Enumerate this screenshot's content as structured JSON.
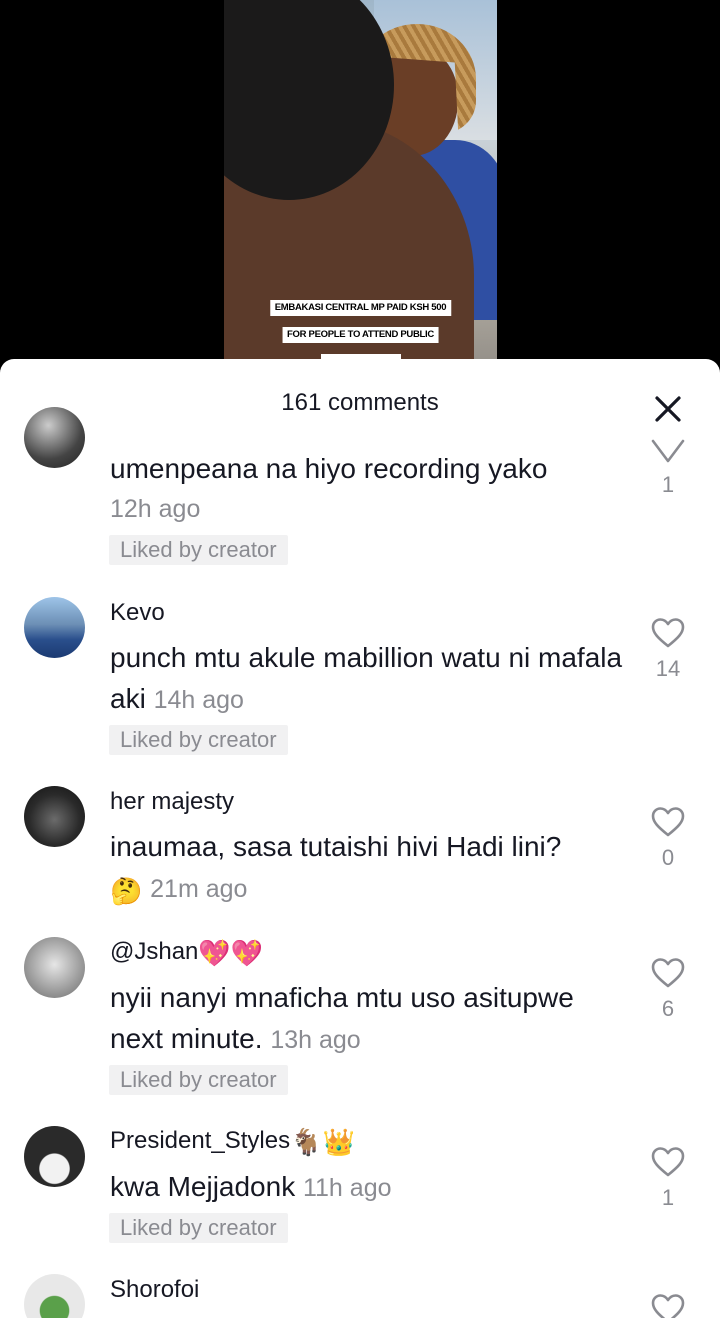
{
  "video": {
    "caption_lines": [
      "EMBAKASI CENTRAL MP PAID KSH 500",
      "FOR PEOPLE TO ATTEND PUBLIC"
    ]
  },
  "sheet": {
    "title": "161 comments",
    "close_icon": "close-icon"
  },
  "comments": [
    {
      "username": "",
      "text": "umenpeana na hiyo recording yako",
      "time": "12h ago",
      "liked_label": "Liked by creator",
      "likes": "1"
    },
    {
      "username": "Kevo",
      "text": "punch mtu akule mabillion watu ni mafala aki",
      "time": "14h ago",
      "liked_label": "Liked by creator",
      "likes": "14"
    },
    {
      "username": "her majesty",
      "text": "inaumaa, sasa tutaishi hivi Hadi lini?",
      "text_emoji": "🤔",
      "time": "21m ago",
      "likes": "0"
    },
    {
      "username": "@Jshan",
      "username_emoji": "💖💖",
      "text": "nyii nanyi mnaficha mtu uso asitupwe next minute.",
      "time": "13h ago",
      "liked_label": "Liked by creator",
      "likes": "6"
    },
    {
      "username": "President_Styles",
      "username_emoji": "🐐👑",
      "text": "kwa Mejjadonk",
      "time": "11h ago",
      "liked_label": "Liked by creator",
      "likes": "1"
    },
    {
      "username": "Shorofoi"
    }
  ],
  "colors": {
    "text": "#161823",
    "muted": "#8a8b91",
    "badge_bg": "#f1f1f2"
  }
}
